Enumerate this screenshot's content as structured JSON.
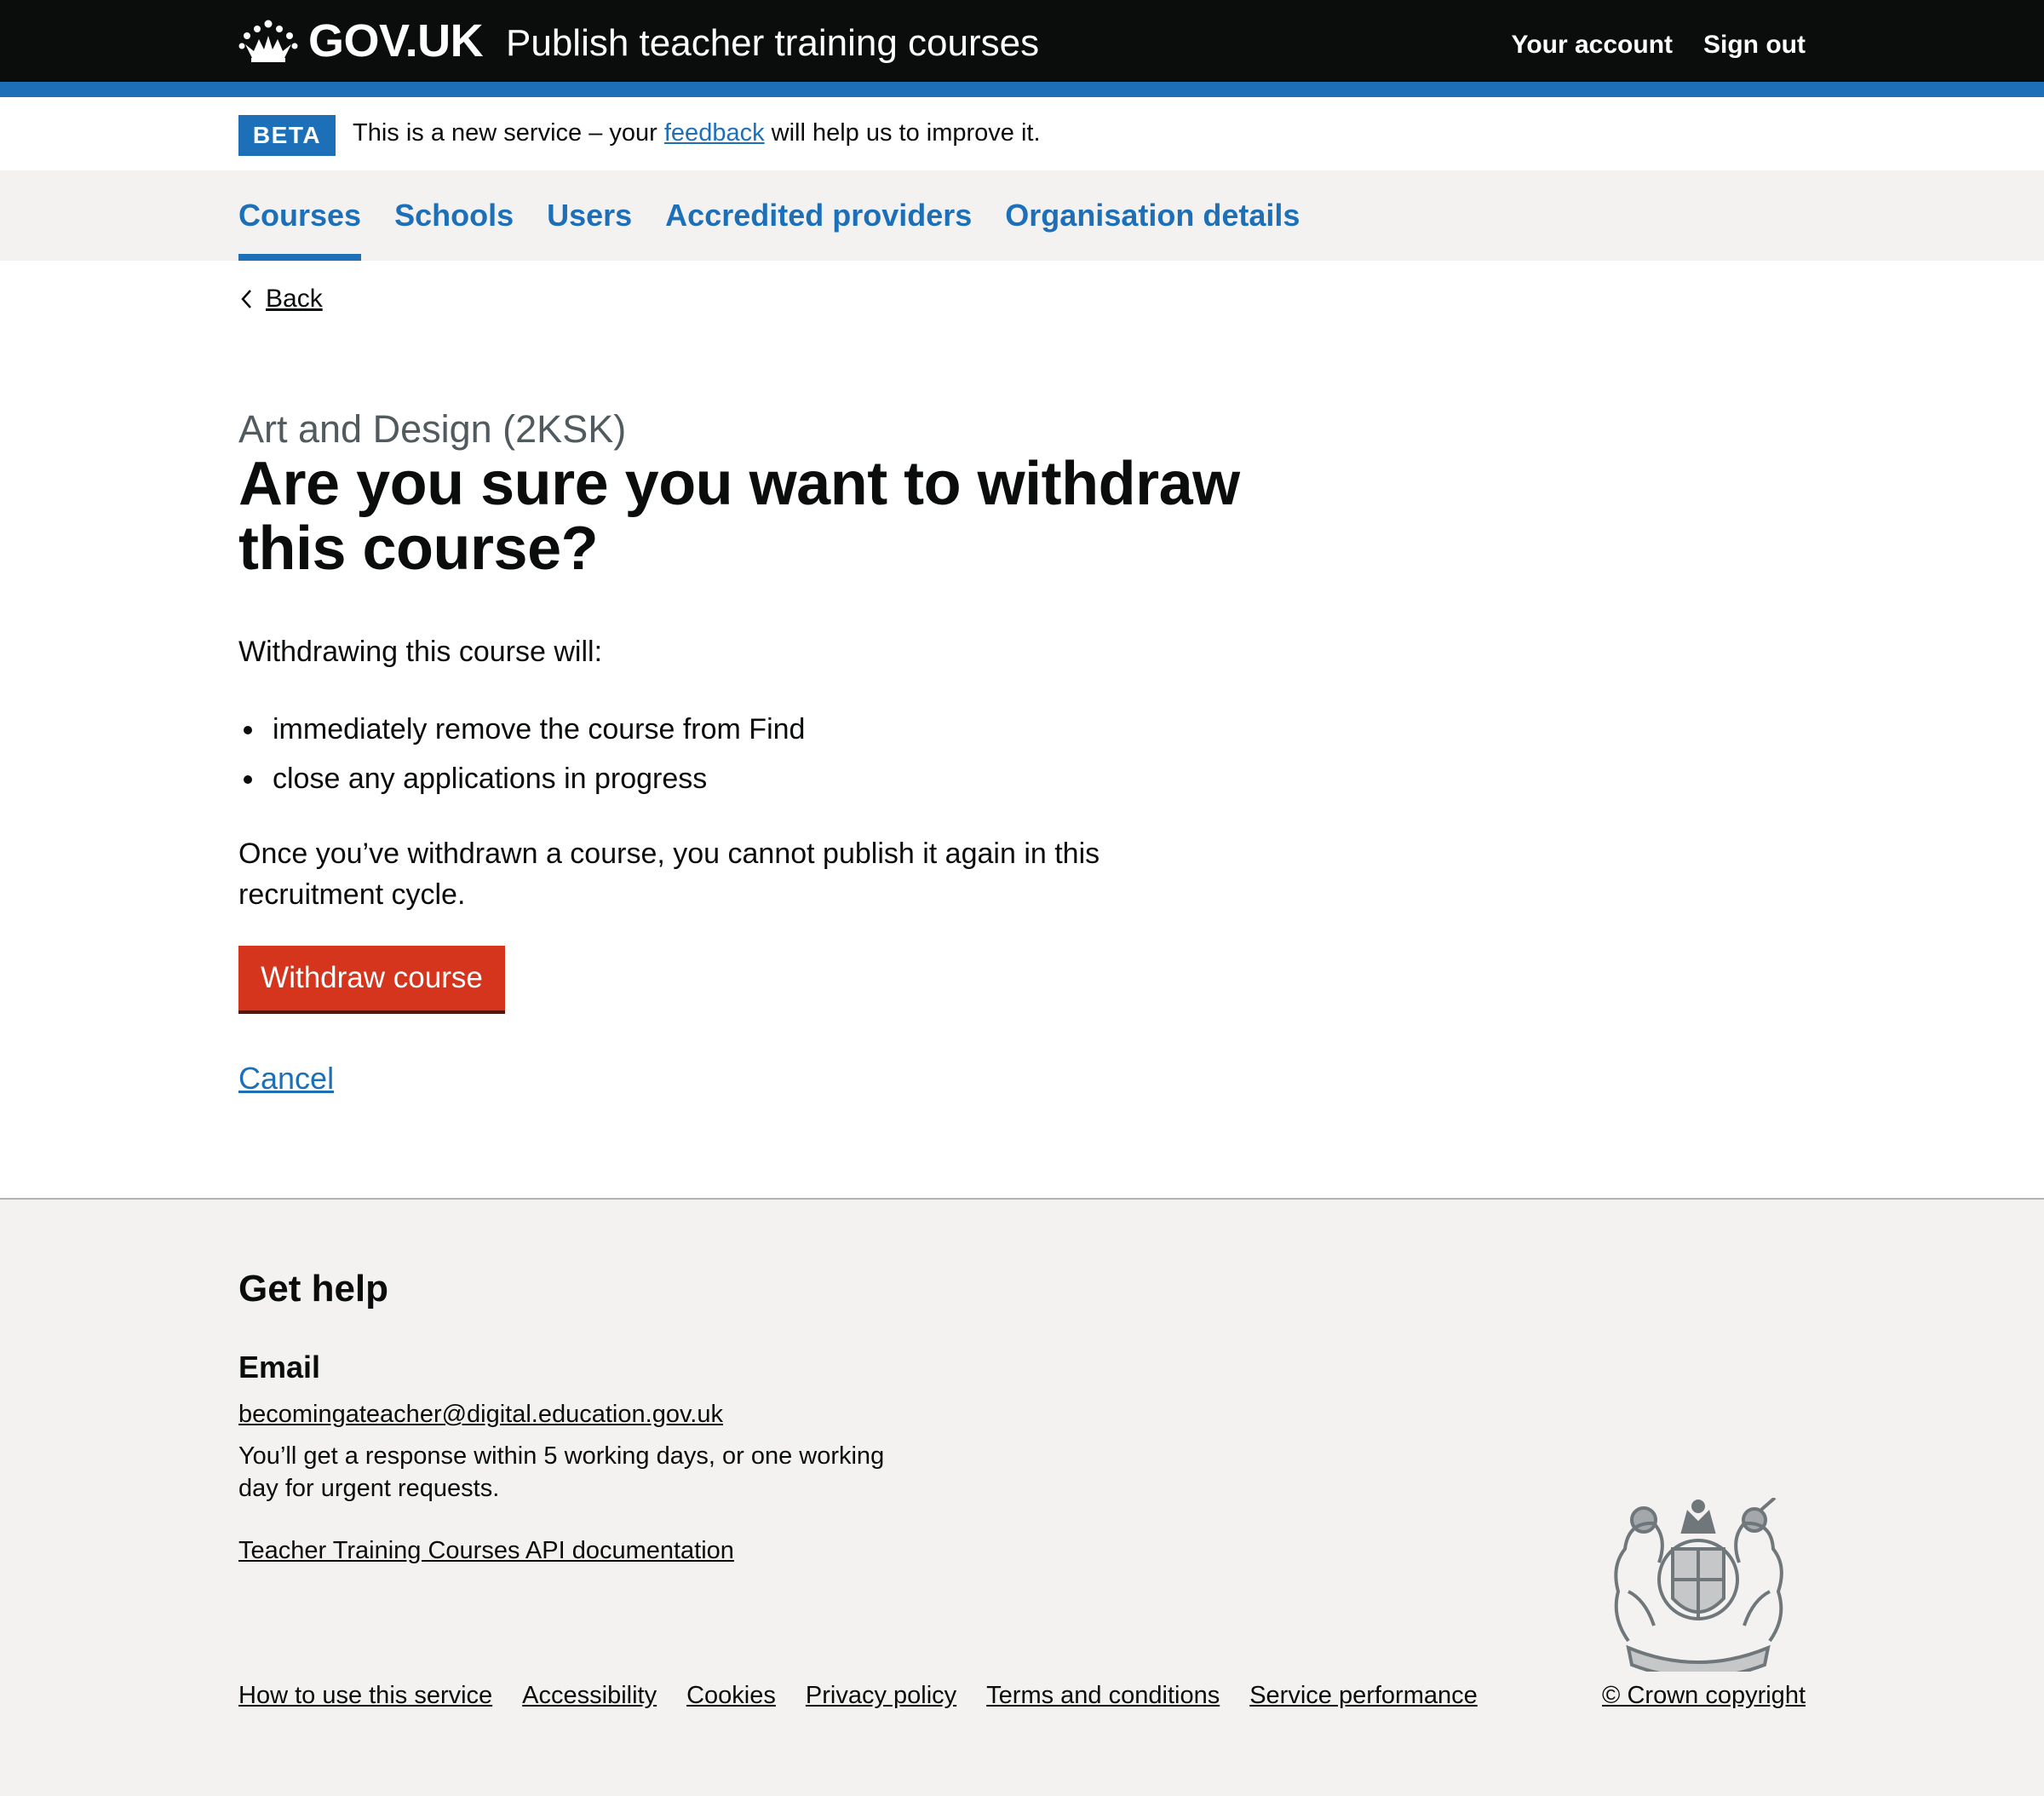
{
  "header": {
    "logo_text": "GOV.UK",
    "service_name": "Publish teacher training courses",
    "links": [
      "Your account",
      "Sign out"
    ]
  },
  "beta_banner": {
    "tag": "BETA",
    "text_before": "This is a new service – your",
    "link": "feedback",
    "text_after": "will help us to improve it."
  },
  "nav": {
    "items": [
      "Courses",
      "Schools",
      "Users",
      "Accredited providers",
      "Organisation details"
    ],
    "active": "Courses"
  },
  "main": {
    "back_label": "Back",
    "caption": "Art and Design (2KSK)",
    "heading": "Are you sure you want to withdraw this course?",
    "lead": "Withdrawing this course will:",
    "bullets": [
      "immediately remove the course from Find",
      "close any applications in progress"
    ],
    "paragraph": "Once you’ve withdrawn a course, you cannot publish it again in this recruitment cycle.",
    "withdraw_button": "Withdraw course",
    "cancel_link": "Cancel"
  },
  "footer": {
    "help_title": "Get help",
    "email_title": "Email",
    "email": "becomingateacher@digital.education.gov.uk",
    "response_text": "You’ll get a response within 5 working days, or one working day for urgent requests.",
    "api_link": "Teacher Training Courses API documentation",
    "links": [
      "How to use this service",
      "Accessibility",
      "Cookies",
      "Privacy policy",
      "Terms and conditions",
      "Service performance"
    ],
    "copyright": "© Crown copyright"
  },
  "colors": {
    "header_bg": "#0b0c0c",
    "brand_blue": "#1d70b8",
    "warning_red": "#d4351c",
    "footer_bg": "#f3f2f1",
    "secondary_text": "#505a5f"
  },
  "icons": [
    "crown-icon",
    "chevron-left-icon",
    "royal-coat-of-arms-icon"
  ]
}
